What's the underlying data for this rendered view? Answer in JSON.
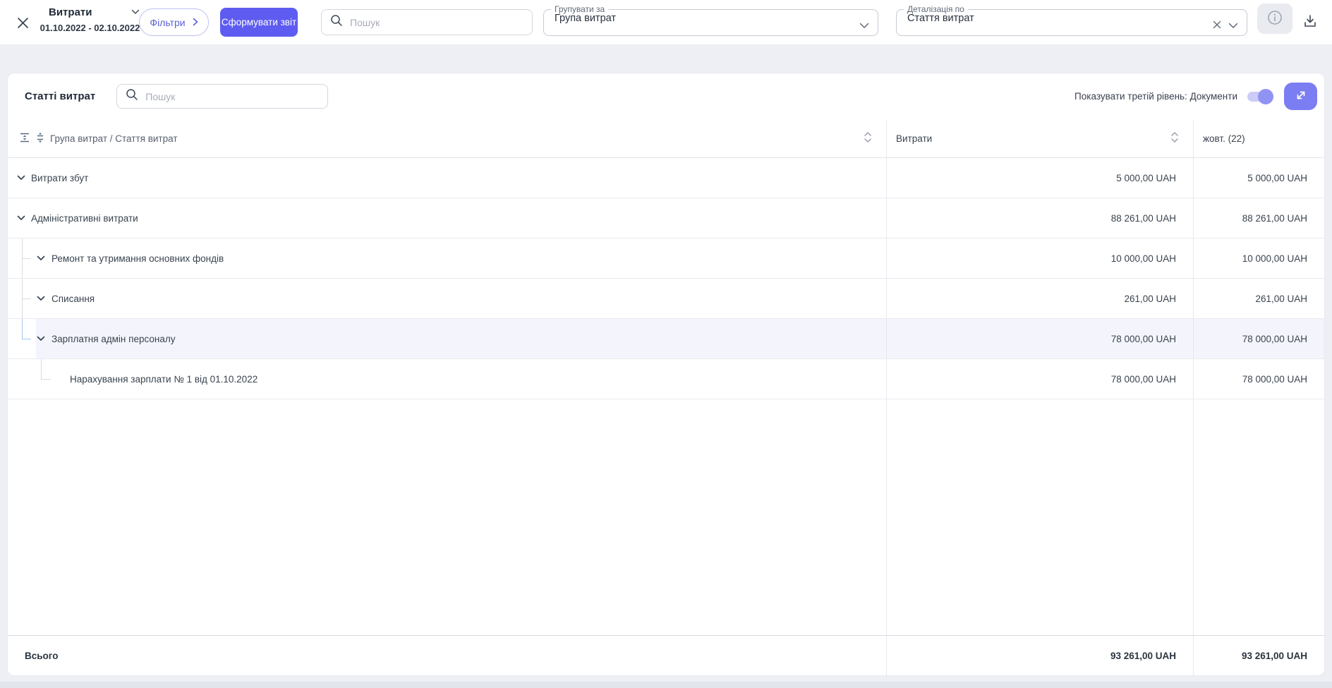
{
  "topbar": {
    "title": "Витрати",
    "date_range": "01.10.2022 - 02.10.2022",
    "filters_button": "Фільтри",
    "generate_report_button": "Сформувати звіт",
    "search_placeholder": "Пошук",
    "group_by": {
      "label": "Групувати за",
      "value": "Група витрат"
    },
    "detail_by": {
      "label": "Деталізація по",
      "value": "Стаття витрат"
    }
  },
  "panel": {
    "title": "Статті витрат",
    "search_placeholder": "Пошук",
    "third_level_toggle_label": "Показувати третій рівень: Документи",
    "toggle_state": "on"
  },
  "table": {
    "columns": {
      "tree": "Група витрат / Стаття витрат",
      "expenses": "Витрати",
      "month": "жовт. (22)"
    },
    "rows": [
      {
        "label": "Витрати збут",
        "level": 1,
        "expenses": "5 000,00 UAH",
        "month": "5 000,00 UAH"
      },
      {
        "label": "Адміністративні витрати",
        "level": 1,
        "expenses": "88 261,00 UAH",
        "month": "88 261,00 UAH"
      },
      {
        "label": "Ремонт та утримання основних фондів",
        "level": 2,
        "expenses": "10 000,00 UAH",
        "month": "10 000,00 UAH"
      },
      {
        "label": "Списання",
        "level": 2,
        "expenses": "261,00 UAH",
        "month": "261,00 UAH"
      },
      {
        "label": "Зарплатня адмін персоналу",
        "level": 2,
        "highlighted": true,
        "expenses": "78 000,00 UAH",
        "month": "78 000,00 UAH"
      },
      {
        "label": "Нарахування зарплати № 1 від 01.10.2022",
        "level": 3,
        "expenses": "78 000,00 UAH",
        "month": "78 000,00 UAH"
      }
    ],
    "footer": {
      "label": "Всього",
      "expenses": "93 261,00 UAH",
      "month": "93 261,00 UAH"
    }
  },
  "icons": {
    "close-icon": "×",
    "chevron-down-icon": "⌄",
    "chevron-right-icon": "❯",
    "search-icon": "magnifier",
    "clear-icon": "×",
    "info-icon": "ⓘ",
    "download-icon": "⤓",
    "expand-icon": "⤢",
    "collapse-rows-icon": "unfold-less",
    "expand-rows-icon": "unfold-more",
    "sort-icon": "˄˅"
  },
  "colors": {
    "accent": "#5e5cf0",
    "accent_light": "#7b7df2",
    "page_background": "#edeff4",
    "highlight_row": "#f4f5fc",
    "tree_connector": "#d9dce2",
    "tree_connector_active": "#a5c8e9"
  }
}
